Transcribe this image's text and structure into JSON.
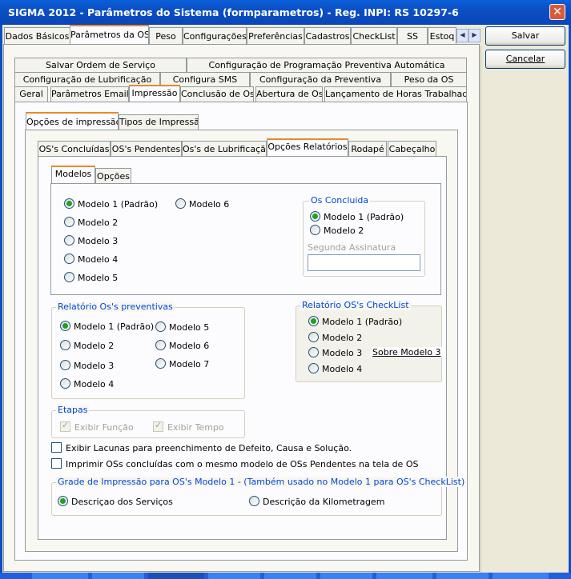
{
  "window": {
    "title": "SIGMA 2012 - Parâmetros do Sistema  (formparametros)  - Reg. INPI: RS 10297-6",
    "close_icon": "close-icon"
  },
  "top_tabs": [
    "Dados Básicos",
    "Parâmetros da OS",
    "Peso",
    "Configurações",
    "Preferências",
    "Cadastros",
    "CheckList",
    "SS",
    "Estoq"
  ],
  "buttons": {
    "save": "Salvar",
    "cancel": "Cancelar"
  },
  "os_tabs": {
    "row1": [
      "Salvar Ordem de Serviço",
      "Configuração de Programação Preventiva Automática"
    ],
    "row2": [
      "Configuração de Lubrificação",
      "Configura SMS",
      "Configuração da Preventiva",
      "Peso da OS"
    ],
    "row3": [
      "Geral",
      "Parâmetros Email",
      "Impressão",
      "Conclusão de Os",
      "Abertura de Os",
      "Lançamento de Horas Trabalhadas"
    ]
  },
  "print_tabs": [
    "Opções de impressão",
    "Tipos de Impressão"
  ],
  "report_tabs": [
    "OS's Concluídas",
    "OS's Pendentes",
    "Os's de Lubrificação",
    "Opções Relatórios",
    "Rodapé",
    "Cabeçalho"
  ],
  "model_tabs": [
    "Modelos",
    "Opções"
  ],
  "models": {
    "col1": [
      "Modelo 1 (Padrão)",
      "Modelo 2",
      "Modelo 3",
      "Modelo 4",
      "Modelo 5"
    ],
    "col2": [
      "Modelo 6"
    ],
    "selected": "Modelo 1 (Padrão)"
  },
  "os_concluida": {
    "title": "Os Concluida",
    "options": [
      "Modelo 1 (Padrão)",
      "Modelo 2"
    ],
    "second_signature_label": "Segunda Assinatura",
    "second_signature_value": ""
  },
  "preventivas": {
    "title": "Relatório Os's preventivas",
    "col1": [
      "Modelo 1 (Padrão)",
      "Modelo 2",
      "Modelo 3",
      "Modelo 4"
    ],
    "col2": [
      "Modelo 5",
      "Modelo 6",
      "Modelo 7"
    ]
  },
  "checklist": {
    "title": "Relatório OS's CheckList",
    "options": [
      "Modelo 1 (Padrão)",
      "Modelo 2",
      "Modelo 3",
      "Modelo 4"
    ],
    "link": "Sobre Modelo 3"
  },
  "etapas": {
    "title": "Etapas",
    "exibir_funcao": "Exibir Função",
    "exibir_tempo": "Exibir Tempo"
  },
  "options": {
    "lacunas": "Exibir Lacunas para preenchimento de Defeito, Causa e Solução.",
    "imprimir": "Imprimir OSs concluídas com o mesmo modelo de OSs Pendentes na tela de OS"
  },
  "grade": {
    "title": "Grade de Impressão para OS's Modelo 1 - (Também usado no Modelo 1 para OS's CheckList)",
    "opt1": "Descriçao dos Serviços",
    "opt2": "Descrição da Kilometragem"
  },
  "colors": {
    "titlebar": "#0b4fc4",
    "accent_tab": "#e68b2c",
    "group_label": "#0046d5",
    "radio_on": "#21a121"
  }
}
